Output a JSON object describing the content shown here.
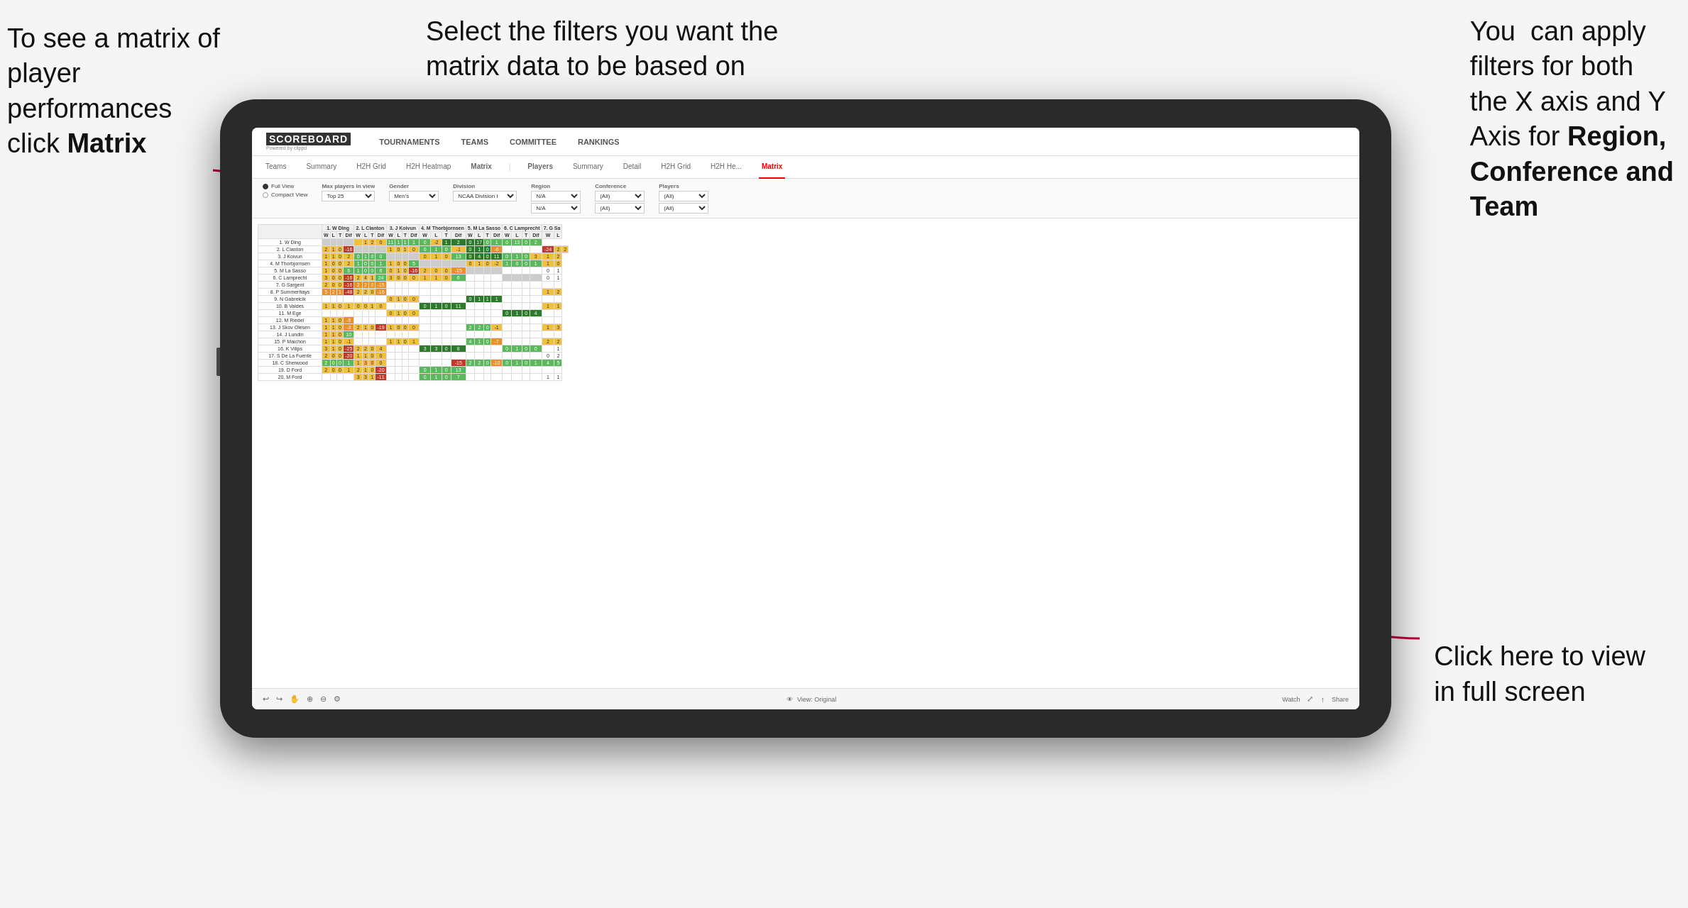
{
  "annotations": {
    "top_left": "To see a matrix of player performances click Matrix",
    "top_left_plain": "To see a matrix of\nplayer performances\nclick ",
    "top_left_bold": "Matrix",
    "top_center": "Select the filters you want the matrix data to be based on",
    "top_right_plain": "You  can apply\nfilters for both\nthe X axis and Y\nAxis for ",
    "top_right_bold": "Region,\nConference and\nTeam",
    "bottom_right_line1": "Click here to view",
    "bottom_right_line2": "in full screen"
  },
  "nav": {
    "logo": "SCOREBOARD",
    "logo_sub": "Powered by clippd",
    "items": [
      "TOURNAMENTS",
      "TEAMS",
      "COMMITTEE",
      "RANKINGS"
    ]
  },
  "tabs": {
    "items": [
      "Teams",
      "Summary",
      "H2H Grid",
      "H2H Heatmap",
      "Matrix",
      "Players",
      "Summary",
      "Detail",
      "H2H Grid",
      "H2H He...",
      "Matrix"
    ],
    "active": "Matrix"
  },
  "filters": {
    "view_options": [
      "Full View",
      "Compact View"
    ],
    "active_view": "Full View",
    "max_players": {
      "label": "Max players in view",
      "value": "Top 25"
    },
    "gender": {
      "label": "Gender",
      "value": "Men's"
    },
    "division": {
      "label": "Division",
      "value": "NCAA Division I"
    },
    "region": {
      "label": "Region",
      "value1": "N/A",
      "value2": "N/A"
    },
    "conference": {
      "label": "Conference",
      "value1": "(All)",
      "value2": "(All)"
    },
    "players": {
      "label": "Players",
      "value1": "(All)",
      "value2": "(All)"
    }
  },
  "matrix": {
    "col_headers": [
      "1. W Ding",
      "2. L Clanton",
      "3. J Koivun",
      "4. M Thorbjornsen",
      "5. M La Sasso",
      "6. C Lamprecht",
      "7. G Sa"
    ],
    "sub_headers": [
      "W",
      "L",
      "T",
      "Dif"
    ],
    "rows": [
      {
        "name": "1. W Ding",
        "cells": []
      },
      {
        "name": "2. L Clanton",
        "cells": []
      },
      {
        "name": "3. J Koivun",
        "cells": []
      },
      {
        "name": "4. M Thorbjornsen",
        "cells": []
      },
      {
        "name": "5. M La Sasso",
        "cells": []
      },
      {
        "name": "6. C Lamprecht",
        "cells": []
      },
      {
        "name": "7. G Sargent",
        "cells": []
      },
      {
        "name": "8. P Summerhays",
        "cells": []
      },
      {
        "name": "9. N Gabrelcik",
        "cells": []
      },
      {
        "name": "10. B Valdes",
        "cells": []
      },
      {
        "name": "11. M Ege",
        "cells": []
      },
      {
        "name": "12. M Riedel",
        "cells": []
      },
      {
        "name": "13. J Skov Olesen",
        "cells": []
      },
      {
        "name": "14. J Lundin",
        "cells": []
      },
      {
        "name": "15. P Maichon",
        "cells": []
      },
      {
        "name": "16. K Vilips",
        "cells": []
      },
      {
        "name": "17. S De La Fuente",
        "cells": []
      },
      {
        "name": "18. C Sherwood",
        "cells": []
      },
      {
        "name": "19. D Ford",
        "cells": []
      },
      {
        "name": "20. M Ford",
        "cells": []
      }
    ]
  },
  "bottom_bar": {
    "view_label": "View: Original",
    "watch_label": "Watch",
    "share_label": "Share"
  }
}
